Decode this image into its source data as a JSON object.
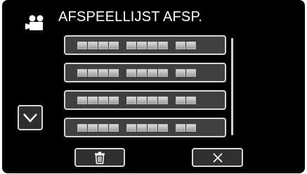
{
  "header": {
    "title": "AFSPEELLIJST AFSP.",
    "mode_icon": "video-camera-icon"
  },
  "playlist": {
    "rows": [
      {
        "label": "placeholder-blocks"
      },
      {
        "label": "placeholder-blocks"
      },
      {
        "label": "placeholder-blocks"
      },
      {
        "label": "placeholder-blocks"
      }
    ]
  },
  "controls": {
    "scroll_down_icon": "chevron-down-icon",
    "delete_icon": "trash-icon",
    "close_icon": "close-icon"
  },
  "colors": {
    "background": "#000000",
    "button_border": "#d7d7d7",
    "text": "#ffffff"
  }
}
